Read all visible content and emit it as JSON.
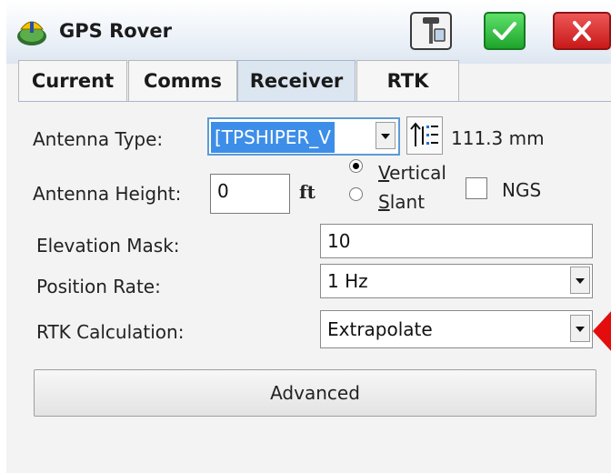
{
  "window": {
    "title": "GPS Rover",
    "buttons": {
      "tool": "antenna-settings",
      "ok": "check",
      "close": "close"
    }
  },
  "tabs": [
    {
      "label": "Current",
      "active": false
    },
    {
      "label": "Comms",
      "active": false
    },
    {
      "label": "Receiver",
      "active": true
    },
    {
      "label": "RTK",
      "active": false
    }
  ],
  "antenna": {
    "type_label": "Antenna Type:",
    "type_value": "[TPSHIPER_V",
    "offset_value": "111.3 mm",
    "height_label": "Antenna Height:",
    "height_value": "0",
    "height_unit": "ft",
    "measure_options": [
      {
        "label": "Vertical",
        "selected": true
      },
      {
        "label": "Slant",
        "selected": false
      }
    ],
    "ngs_label": "NGS",
    "ngs_checked": false
  },
  "elevation_mask": {
    "label": "Elevation Mask:",
    "value": "10"
  },
  "position_rate": {
    "label": "Position Rate:",
    "value": "1 Hz"
  },
  "rtk_calculation": {
    "label": "RTK Calculation:",
    "value": "Extrapolate"
  },
  "advanced_button": "Advanced",
  "annotation": {
    "pointer": "red-arrow",
    "color": "#e30d0d"
  },
  "colors": {
    "active_tab": "#dce6f1",
    "ok_button": "#29b036",
    "close_button": "#d32020"
  }
}
